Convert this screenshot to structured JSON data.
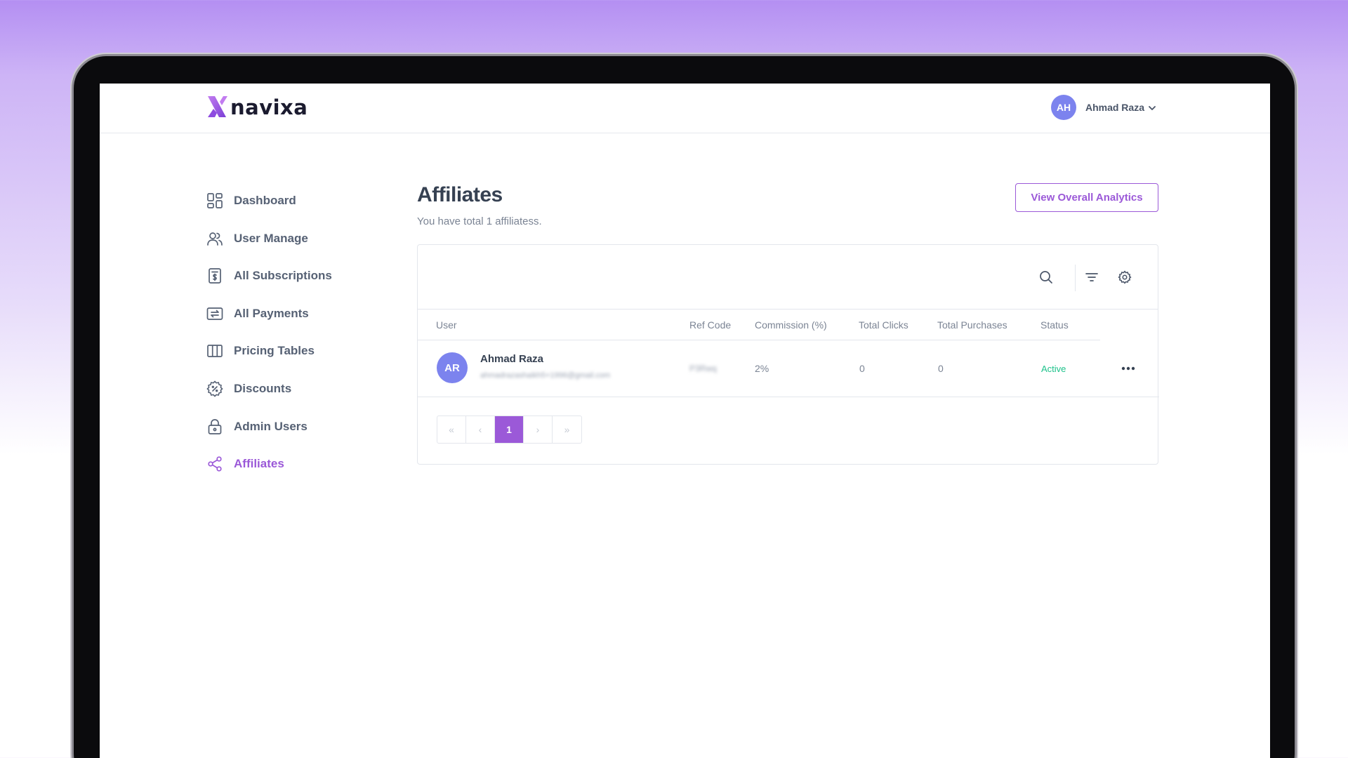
{
  "header": {
    "brand": "navixa",
    "user_initials": "AH",
    "user_name": "Ahmad Raza"
  },
  "sidebar": {
    "items": [
      {
        "label": "Dashboard",
        "icon": "dashboard-grid-icon",
        "active": false
      },
      {
        "label": "User Manage",
        "icon": "users-icon",
        "active": false
      },
      {
        "label": "All Subscriptions",
        "icon": "subscription-receipt-icon",
        "active": false
      },
      {
        "label": "All Payments",
        "icon": "payments-transfer-icon",
        "active": false
      },
      {
        "label": "Pricing Tables",
        "icon": "columns-icon",
        "active": false
      },
      {
        "label": "Discounts",
        "icon": "discount-badge-icon",
        "active": false
      },
      {
        "label": "Admin Users",
        "icon": "lock-icon",
        "active": false
      },
      {
        "label": "Affiliates",
        "icon": "share-icon",
        "active": true
      }
    ]
  },
  "main": {
    "title": "Affiliates",
    "subtitle": "You have total 1 affiliatess.",
    "analytics_button": "View Overall Analytics"
  },
  "table": {
    "columns": [
      "User",
      "Ref Code",
      "Commission (%)",
      "Total Clicks",
      "Total Purchases",
      "Status"
    ],
    "rows": [
      {
        "initials": "AR",
        "name": "Ahmad Raza",
        "email": "ahmadrazashaikh5+1996@gmail.com",
        "ref_code": "P3Rwq",
        "commission": "2%",
        "clicks": "0",
        "purchases": "0",
        "status": "Active"
      }
    ]
  },
  "pagination": {
    "first": "«",
    "prev": "‹",
    "current": "1",
    "next": "›",
    "last": "»"
  },
  "colors": {
    "accent": "#9b59d8",
    "avatar": "#7c83ee",
    "status_active": "#1ec28b",
    "text_muted": "#7b8494"
  }
}
